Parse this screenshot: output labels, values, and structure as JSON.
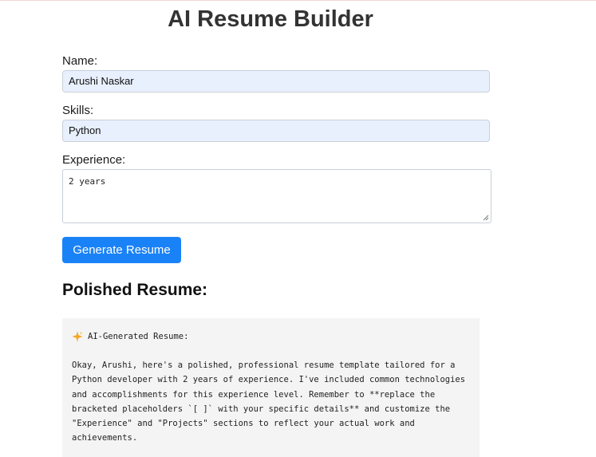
{
  "page": {
    "title": "AI Resume Builder"
  },
  "form": {
    "name_label": "Name:",
    "name_value": "Arushi Naskar",
    "skills_label": "Skills:",
    "skills_value": "Python",
    "experience_label": "Experience:",
    "experience_value": "2 years",
    "generate_button": "Generate Resume"
  },
  "output": {
    "heading": "Polished Resume:",
    "header_icon": "sparkle-icon",
    "header_text": "AI-Generated Resume:",
    "lines": [
      "Okay, Arushi, here's a polished, professional resume template tailored for a",
      "Python developer with 2 years of experience. I've included common technologies",
      "and accomplishments for this experience level. Remember to **replace the",
      "bracketed placeholders `[ ]` with your specific details** and customize the",
      "\"Experience\" and \"Projects\" sections to reflect your actual work and",
      "achievements."
    ]
  },
  "colors": {
    "button_bg": "#1a82f7",
    "input_bg": "#e8f0fe",
    "output_bg": "#f4f4f4",
    "sparkle": "#f5a623"
  }
}
